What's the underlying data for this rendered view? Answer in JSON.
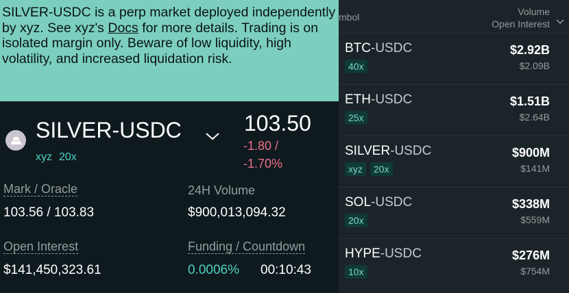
{
  "tooltip": {
    "text_before": "SILVER-USDC is a perp market deployed independently by xyz. See xyz's ",
    "docs_link": "Docs",
    "text_after": " for more details. Trading is on isolated margin only. Beware of low liquidity, high volatility, and increased liquidation risk."
  },
  "market": {
    "name": "SILVER-USDC",
    "deployer": "xyz",
    "leverage": "20x",
    "price": "103.50",
    "change_abs": "-1.80 /",
    "change_pct": "-1.70%"
  },
  "stats": {
    "mark_label": "Mark / Oracle",
    "mark_value": "103.56 / 103.83",
    "volume_label": "24H Volume",
    "volume_value": "$900,013,094.32",
    "oi_label": "Open Interest",
    "oi_value": "$141,450,323.61",
    "funding_label": "Funding / Countdown",
    "funding_value": "0.0006%",
    "countdown_value": "00:10:43"
  },
  "list": {
    "header_symbol": "mbol",
    "header_volume": "Volume",
    "header_oi": "Open Interest",
    "rows": [
      {
        "base": "BTC",
        "quote": "-USDC",
        "tags": [
          "40x"
        ],
        "volume": "$2.92B",
        "oi": "$2.09B"
      },
      {
        "base": "ETH",
        "quote": "-USDC",
        "tags": [
          "25x"
        ],
        "volume": "$1.51B",
        "oi": "$2.64B"
      },
      {
        "base": "SILVER",
        "quote": "-USDC",
        "tags": [
          "xyz",
          "20x"
        ],
        "volume": "$900M",
        "oi": "$141M"
      },
      {
        "base": "SOL",
        "quote": "-USDC",
        "tags": [
          "20x"
        ],
        "volume": "$338M",
        "oi": "$559M"
      },
      {
        "base": "HYPE",
        "quote": "-USDC",
        "tags": [
          "10x"
        ],
        "volume": "$276M",
        "oi": "$754M"
      }
    ]
  },
  "colors": {
    "tooltip_bg": "#7ccfbf",
    "accent_teal": "#50d2c1",
    "negative": "#ed7088",
    "panel_bg": "#0f1a1f",
    "list_bg": "#1b2429"
  },
  "icons": [
    "silver-bars-icon",
    "chevron-down-icon"
  ]
}
